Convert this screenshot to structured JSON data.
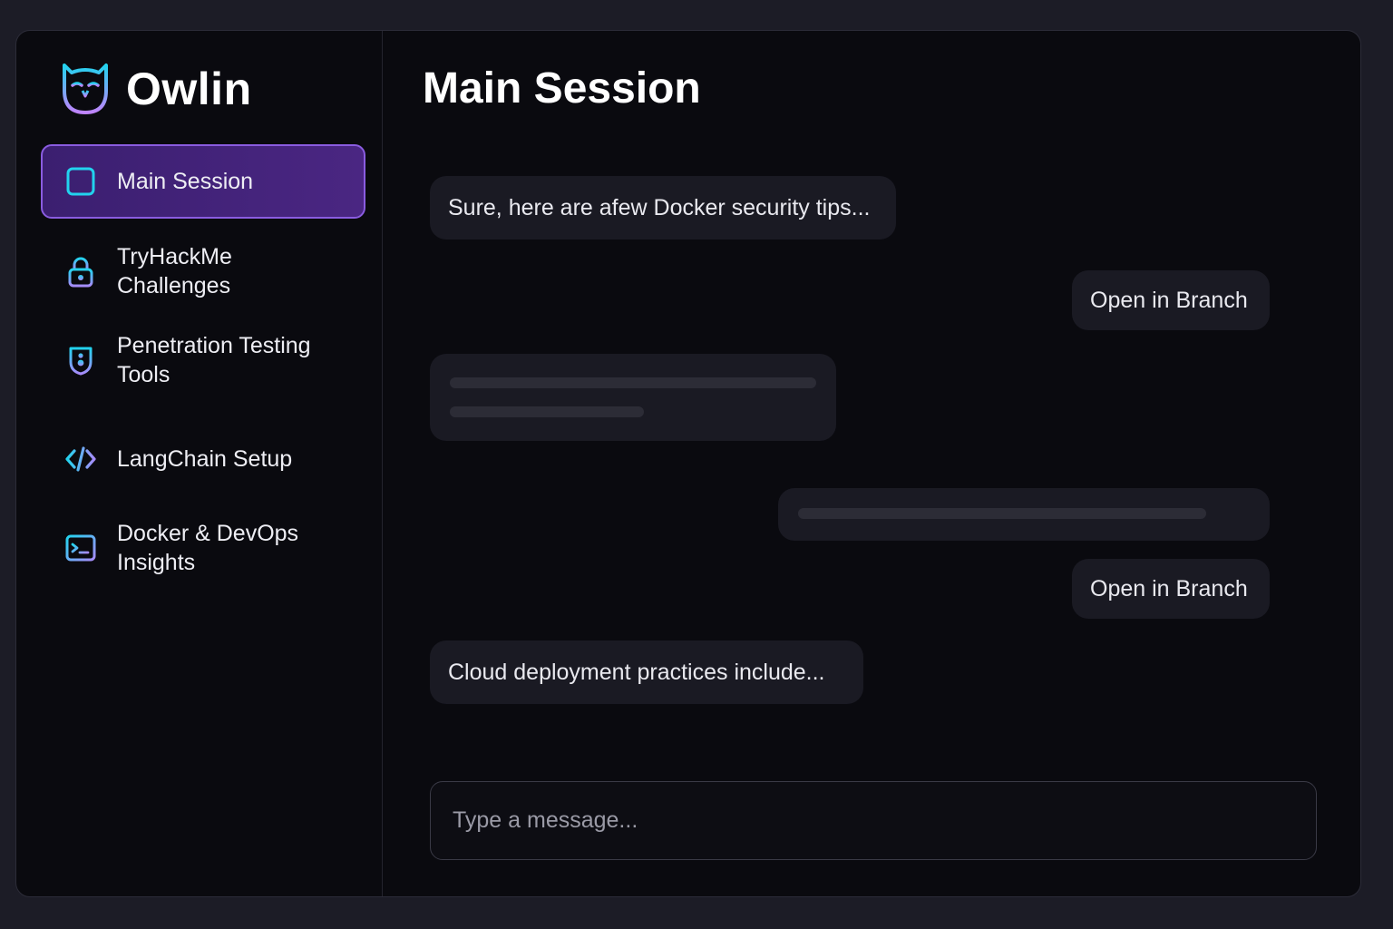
{
  "app": {
    "name": "Owlin",
    "logo_icon": "owl-icon",
    "accent_colors": [
      "#22d3ee",
      "#a855f7"
    ]
  },
  "sidebar": {
    "items": [
      {
        "label": "Main Session",
        "icon": "square-icon",
        "active": true
      },
      {
        "label": "TryHackMe Challenges",
        "icon": "lock-icon",
        "active": false
      },
      {
        "label": "Penetration Testing Tools",
        "icon": "shield-icon",
        "active": false
      },
      {
        "label": "LangChain Setup",
        "icon": "code-icon",
        "active": false
      },
      {
        "label": "Docker & DevOps Insights",
        "icon": "terminal-icon",
        "active": false
      }
    ]
  },
  "main": {
    "title": "Main Session",
    "messages": [
      {
        "type": "text",
        "side": "left",
        "text": "Sure, here are afew Docker security tips..."
      },
      {
        "type": "button",
        "side": "right",
        "text": "Open in Branch"
      },
      {
        "type": "placeholder",
        "side": "left"
      },
      {
        "type": "placeholder",
        "side": "right"
      },
      {
        "type": "button",
        "side": "right",
        "text": "Open in Branch"
      },
      {
        "type": "text",
        "side": "left",
        "text": "Cloud deployment practices include..."
      }
    ],
    "composer": {
      "placeholder": "Type a message...",
      "value": ""
    }
  }
}
